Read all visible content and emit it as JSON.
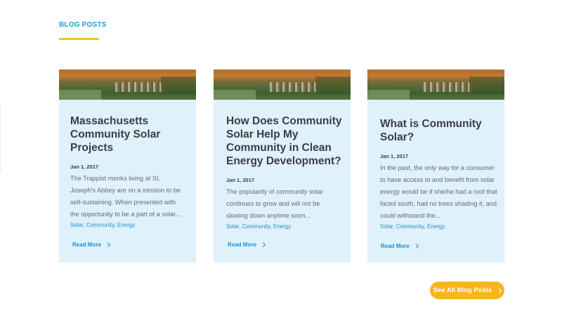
{
  "section": {
    "title": "BLOG POSTS",
    "accent_color": "#f7c21b"
  },
  "posts": [
    {
      "title": "Massachusetts Community Solar Projects",
      "date": "Jan 1, 2017",
      "excerpt": "The Trappist monks living at St. Joseph's Abbey are on a mission to be self-sustaining. When presented with the opportunity to be a part of a solar...",
      "tags": [
        "Solar",
        "Community",
        "Energy"
      ],
      "read_more": "Read More"
    },
    {
      "title": "How Does Community Solar Help My Community in Clean Energy Development?",
      "date": "Jan 1, 2017",
      "excerpt": "The popularity of community solar continues to grow and will not be slowing down anytime soon...",
      "tags": [
        "Solar",
        "Community",
        "Energy"
      ],
      "read_more": "Read More"
    },
    {
      "title": "What is Community Solar?",
      "date": "Jan 1, 2017",
      "excerpt": "In the past, the only way for a consumer to have access to and benefit from solar energy would be if she/he had a roof that faced south, had no trees shading it, and could withstand the...",
      "tags": [
        "Solar",
        "Community",
        "Energy"
      ],
      "read_more": "Read More"
    }
  ],
  "cta": {
    "label": "See All Blog Posts",
    "color": "#f8b41b"
  },
  "colors": {
    "link": "#1e8fd0",
    "card_bg": "#dff1fb",
    "heading": "#1aa0d8"
  }
}
